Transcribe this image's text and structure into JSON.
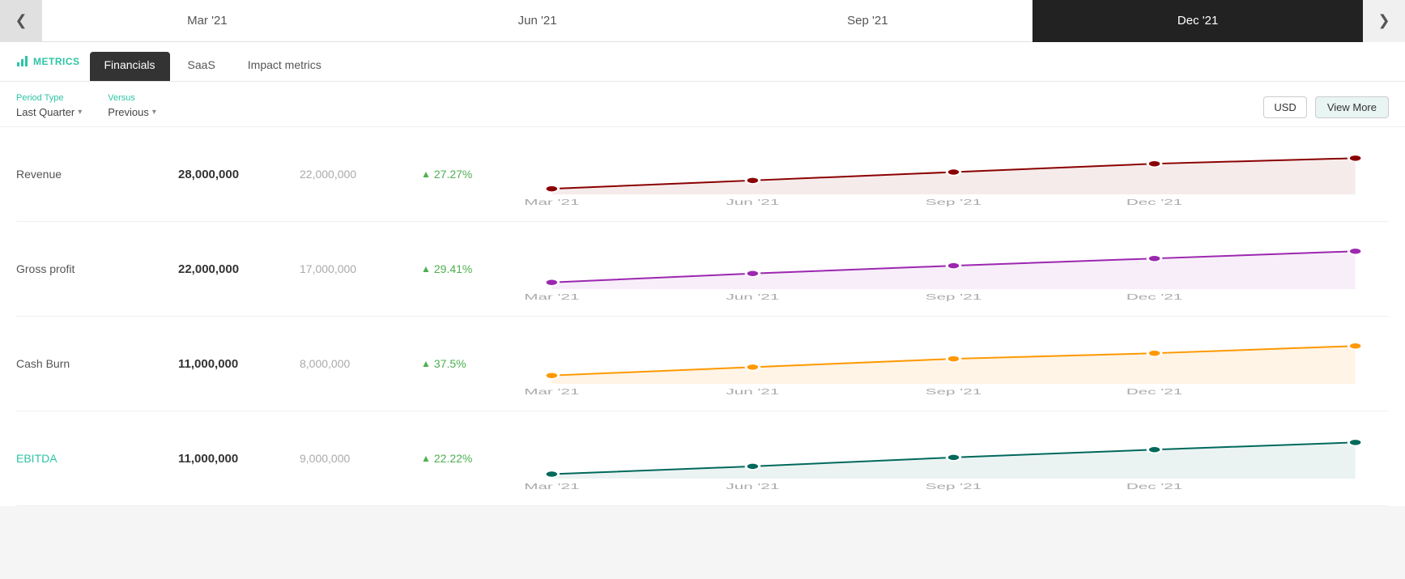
{
  "periodNav": {
    "prevBtn": "❮",
    "nextBtn": "❯",
    "periods": [
      {
        "label": "Mar '21",
        "active": false
      },
      {
        "label": "Jun '21",
        "active": false
      },
      {
        "label": "Sep '21",
        "active": false
      },
      {
        "label": "Dec '21",
        "active": true
      }
    ]
  },
  "tabs": {
    "metricsIcon": "▐",
    "metricsLabel": "METRICS",
    "items": [
      {
        "label": "Financials",
        "active": true
      },
      {
        "label": "SaaS",
        "active": false
      },
      {
        "label": "Impact metrics",
        "active": false
      }
    ]
  },
  "filters": {
    "periodType": {
      "label": "Period Type",
      "value": "Last Quarter"
    },
    "versus": {
      "label": "Versus",
      "value": "Previous"
    },
    "currency": "USD",
    "viewMore": "View More"
  },
  "metrics": [
    {
      "name": "Revenue",
      "isLink": false,
      "current": "28,000,000",
      "previous": "22,000,000",
      "changePercent": "27.27%",
      "changePositive": true,
      "chartColor": "#8b0000",
      "chartFill": "rgba(139,0,0,0.08)",
      "chartPoints": [
        10,
        25,
        40,
        55,
        65
      ]
    },
    {
      "name": "Gross profit",
      "isLink": false,
      "current": "22,000,000",
      "previous": "17,000,000",
      "changePercent": "29.41%",
      "changePositive": true,
      "chartColor": "#9c27b0",
      "chartFill": "rgba(156,39,176,0.08)",
      "chartPoints": [
        12,
        28,
        42,
        55,
        68
      ]
    },
    {
      "name": "Cash Burn",
      "isLink": false,
      "current": "11,000,000",
      "previous": "8,000,000",
      "changePercent": "37.5%",
      "changePositive": true,
      "chartColor": "#ff9800",
      "chartFill": "rgba(255,152,0,0.1)",
      "chartPoints": [
        15,
        30,
        45,
        55,
        68
      ]
    },
    {
      "name": "EBITDA",
      "isLink": true,
      "current": "11,000,000",
      "previous": "9,000,000",
      "changePercent": "22.22%",
      "changePositive": true,
      "chartColor": "#00695c",
      "chartFill": "rgba(0,105,92,0.08)",
      "chartPoints": [
        8,
        22,
        38,
        52,
        65
      ]
    }
  ],
  "chartXLabels": [
    "Mar '21",
    "Jun '21",
    "Sep '21",
    "Dec '21"
  ]
}
